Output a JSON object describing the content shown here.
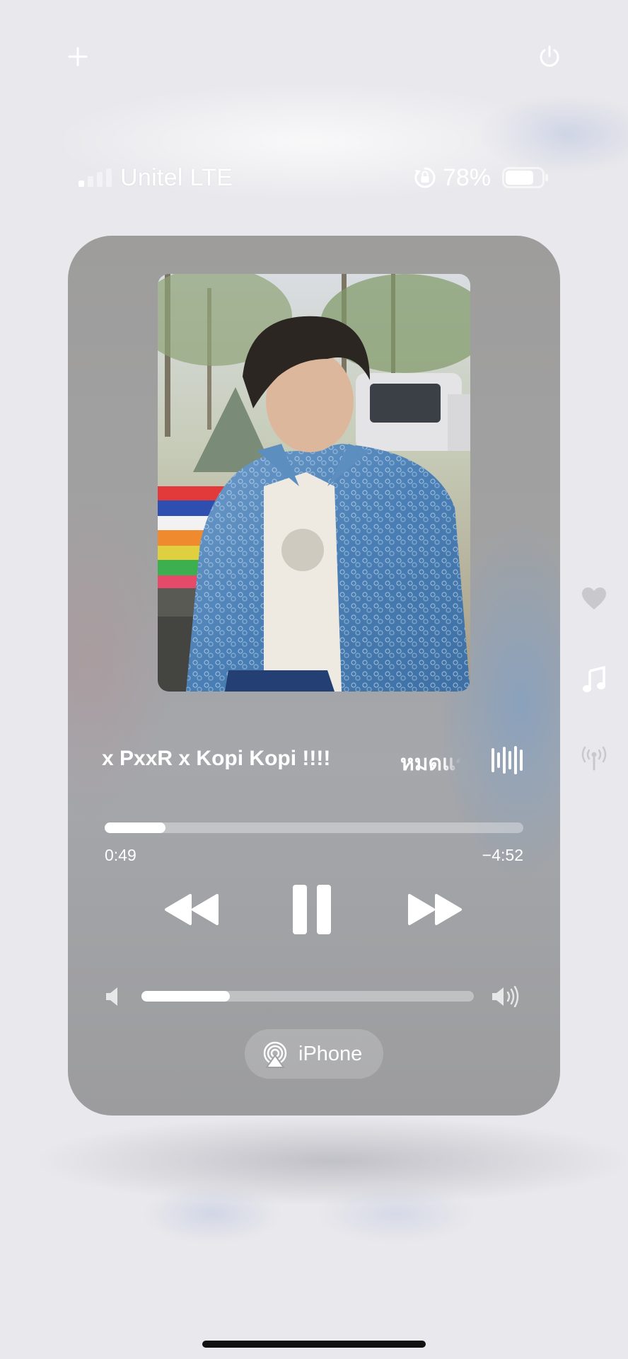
{
  "top_bar": {
    "add_icon": "plus-icon",
    "power_icon": "power-icon"
  },
  "status_bar": {
    "carrier": "Unitel LTE",
    "signal_bars_filled": 1,
    "signal_bars_total": 4,
    "orientation_lock_icon": "orientation-lock-icon",
    "battery_percent": "78%",
    "battery_level": 0.78
  },
  "now_playing": {
    "title": "x  PxxR  x  Kopi Kopi !!!!",
    "title_continued": "หมดแร",
    "artwork_description_icon": "album-artwork",
    "waveform_icon": "audio-waveform-icon",
    "elapsed": "0:49",
    "remaining": "−4:52",
    "progress_fraction": 0.145,
    "controls": {
      "previous_icon": "rewind-icon",
      "play_pause_icon": "pause-icon",
      "next_icon": "fast-forward-icon"
    },
    "volume_fraction": 0.265,
    "volume_low_icon": "speaker-low-icon",
    "volume_high_icon": "speaker-high-icon",
    "output_device": "iPhone",
    "output_icon": "airplay-icon"
  },
  "side_rail": {
    "items": [
      "heart-icon",
      "music-note-icon",
      "broadcast-icon"
    ]
  },
  "colors": {
    "accent": "#ffffff",
    "panel": "#a1a1a2",
    "background": "#e9e8ec"
  }
}
